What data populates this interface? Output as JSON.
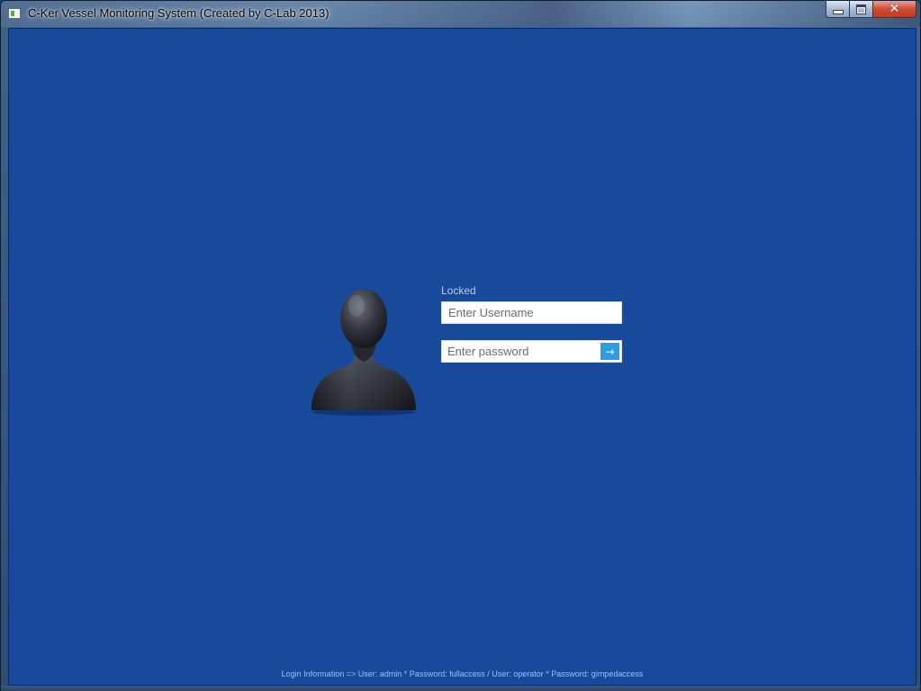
{
  "window": {
    "title": "C-Ker Vessel Monitoring System (Created by C-Lab 2013)",
    "controls": {
      "minimize_icon": "minimize-icon",
      "maximize_icon": "maximize-icon",
      "close_glyph": "✕"
    }
  },
  "login": {
    "status_label": "Locked",
    "username_placeholder": "Enter Username",
    "username_value": "",
    "password_placeholder": "Enter password",
    "password_value": "",
    "submit_glyph": "→",
    "avatar_icon": "user-silhouette-icon"
  },
  "footer": {
    "login_info": "Login Information  =>  User: admin * Password: fullaccess   /   User: operator * Password: gimpedaccess"
  },
  "colors": {
    "background": "#184a9c",
    "submit_button": "#2b9fe6",
    "info_text": "#8fc6f5",
    "label_text": "#b9cce8"
  }
}
